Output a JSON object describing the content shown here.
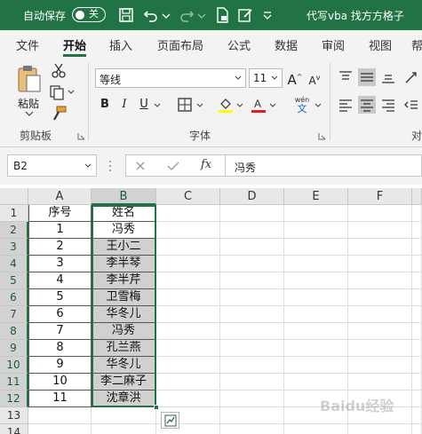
{
  "titlebar": {
    "autosave_label": "自动保存",
    "autosave_state": "关",
    "title": "代写vba 找方方格子"
  },
  "tabs": [
    {
      "label": "文件"
    },
    {
      "label": "开始",
      "active": true
    },
    {
      "label": "插入"
    },
    {
      "label": "页面布局"
    },
    {
      "label": "公式"
    },
    {
      "label": "数据"
    },
    {
      "label": "审阅"
    },
    {
      "label": "视图"
    },
    {
      "label": "帮"
    }
  ],
  "ribbon": {
    "clipboard": {
      "paste_label": "粘贴",
      "group_label": "剪贴板"
    },
    "font": {
      "font_name": "等线",
      "font_size": "11",
      "group_label": "字体",
      "phonetic_label": "wén"
    },
    "alignment": {
      "group_label": "对"
    }
  },
  "formula_bar": {
    "name_box": "B2",
    "fx_label": "fx",
    "formula_value": "冯秀"
  },
  "sheet": {
    "columns": [
      "A",
      "B",
      "C",
      "D",
      "E",
      "F"
    ],
    "rows": [
      "1",
      "2",
      "3",
      "4",
      "5",
      "6",
      "7",
      "8",
      "9",
      "10",
      "11",
      "12",
      "13",
      "14"
    ],
    "header_row": [
      "序号",
      "姓名"
    ],
    "data": [
      {
        "num": "1",
        "name": "冯秀"
      },
      {
        "num": "2",
        "name": "王小二"
      },
      {
        "num": "3",
        "name": "李半琴"
      },
      {
        "num": "4",
        "name": "李半芹"
      },
      {
        "num": "5",
        "name": "卫雪梅"
      },
      {
        "num": "6",
        "name": "华冬儿"
      },
      {
        "num": "7",
        "name": "冯秀"
      },
      {
        "num": "8",
        "name": "孔兰燕"
      },
      {
        "num": "9",
        "name": "华冬儿"
      },
      {
        "num": "10",
        "name": "李二麻子"
      },
      {
        "num": "11",
        "name": "沈章洪"
      }
    ],
    "selected_column": "B",
    "selection_fill_color": "#d0d0d0",
    "accent_color": "#217346"
  },
  "watermark": "Baidu经验"
}
